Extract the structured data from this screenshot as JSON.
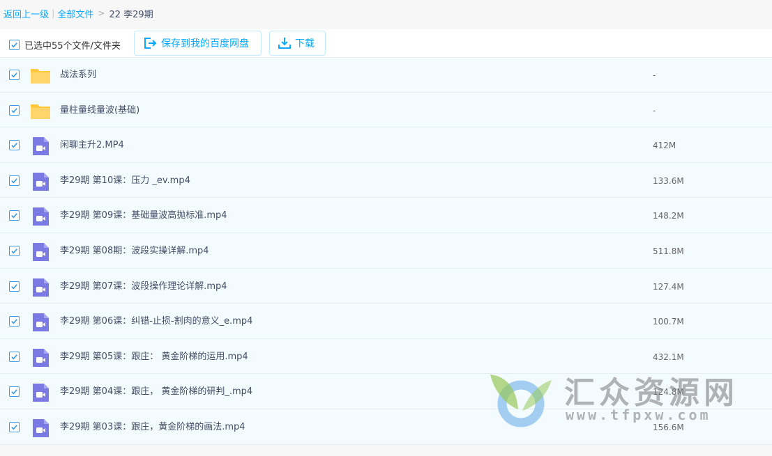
{
  "breadcrumb": {
    "back": "返回上一级",
    "all": "全部文件",
    "separator": "|",
    "arrow": ">",
    "current": "22 李29期"
  },
  "toolbar": {
    "selected_label": "已选中55个文件/文件夹",
    "save_label": "保存到我的百度网盘",
    "download_label": "下载"
  },
  "files": [
    {
      "name": "战法系列",
      "size": "-",
      "type": "folder"
    },
    {
      "name": "量柱量线量波(基础)",
      "size": "-",
      "type": "folder"
    },
    {
      "name": "闲聊主升2.MP4",
      "size": "412M",
      "type": "video"
    },
    {
      "name": "李29期 第10课：压力 _ev.mp4",
      "size": "133.6M",
      "type": "video"
    },
    {
      "name": "李29期 第09课：基础量波高抛标准.mp4",
      "size": "148.2M",
      "type": "video"
    },
    {
      "name": "李29期 第08期：波段实操详解.mp4",
      "size": "511.8M",
      "type": "video"
    },
    {
      "name": "李29期 第07课：波段操作理论详解.mp4",
      "size": "127.4M",
      "type": "video"
    },
    {
      "name": "李29期 第06课：纠错-止损-割肉的意义_e.mp4",
      "size": "100.7M",
      "type": "video"
    },
    {
      "name": "李29期 第05课：跟庄： 黄金阶梯的运用.mp4",
      "size": "432.1M",
      "type": "video"
    },
    {
      "name": "李29期 第04课：跟庄， 黄金阶梯的研判_.mp4",
      "size": "124.8M",
      "type": "video"
    },
    {
      "name": "李29期 第03课：跟庄，黄金阶梯的画法.mp4",
      "size": "156.6M",
      "type": "video"
    }
  ],
  "watermark": {
    "title": "汇众资源网",
    "url": "www.tfpxw.com"
  },
  "colors": {
    "link": "#09aaff",
    "folder": "#ffc83d",
    "video": "#7b79e3",
    "row_bg": "#f4fbfe",
    "check": "#3a9ae8"
  }
}
